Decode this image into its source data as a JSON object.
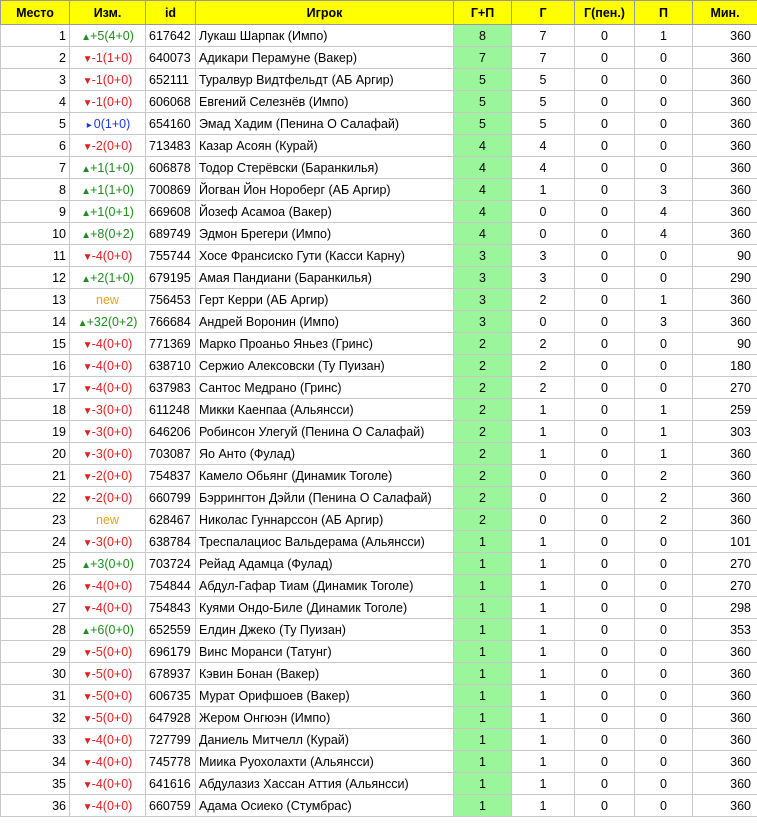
{
  "colors": {
    "header_bg": "#ffff00",
    "points_bg": "#9bf59b",
    "up": "#1e8c1e",
    "down": "#e02020",
    "same": "#1a37e0",
    "new": "#e6a020"
  },
  "icons": {
    "up": "triangle-up-icon",
    "down": "triangle-down-icon",
    "same": "triangle-right-icon"
  },
  "headers": {
    "place": "Место",
    "change": "Изм.",
    "id": "id",
    "player": "Игрок",
    "points": "Г+П",
    "goals": "Г",
    "pen": "Г(пен.)",
    "assists": "П",
    "minutes": "Мин."
  },
  "rows": [
    {
      "place": "1",
      "dir": "up",
      "change": "+5(4+0)",
      "id": "617642",
      "player": "Лукаш Шарпак (Импо)",
      "gp": "8",
      "g": "7",
      "pen": "0",
      "a": "1",
      "min": "360"
    },
    {
      "place": "2",
      "dir": "down",
      "change": "-1(1+0)",
      "id": "640073",
      "player": "Адикари Перамуне (Вакер)",
      "gp": "7",
      "g": "7",
      "pen": "0",
      "a": "0",
      "min": "360"
    },
    {
      "place": "3",
      "dir": "down",
      "change": "-1(0+0)",
      "id": "652111",
      "player": "Туралвур Видтфельдт (АБ Аргир)",
      "gp": "5",
      "g": "5",
      "pen": "0",
      "a": "0",
      "min": "360"
    },
    {
      "place": "4",
      "dir": "down",
      "change": "-1(0+0)",
      "id": "606068",
      "player": "Евгений Селезнёв (Импо)",
      "gp": "5",
      "g": "5",
      "pen": "0",
      "a": "0",
      "min": "360"
    },
    {
      "place": "5",
      "dir": "same",
      "change": "0(1+0)",
      "id": "654160",
      "player": "Эмад Хадим (Пенина О Салафай)",
      "gp": "5",
      "g": "5",
      "pen": "0",
      "a": "0",
      "min": "360"
    },
    {
      "place": "6",
      "dir": "down",
      "change": "-2(0+0)",
      "id": "713483",
      "player": "Казар Асоян (Курай)",
      "gp": "4",
      "g": "4",
      "pen": "0",
      "a": "0",
      "min": "360"
    },
    {
      "place": "7",
      "dir": "up",
      "change": "+1(1+0)",
      "id": "606878",
      "player": "Тодор Стерёвски (Баранкилья)",
      "gp": "4",
      "g": "4",
      "pen": "0",
      "a": "0",
      "min": "360"
    },
    {
      "place": "8",
      "dir": "up",
      "change": "+1(1+0)",
      "id": "700869",
      "player": "Йогван Йон Нороберг (АБ Аргир)",
      "gp": "4",
      "g": "1",
      "pen": "0",
      "a": "3",
      "min": "360"
    },
    {
      "place": "9",
      "dir": "up",
      "change": "+1(0+1)",
      "id": "669608",
      "player": "Йозеф Асамоа (Вакер)",
      "gp": "4",
      "g": "0",
      "pen": "0",
      "a": "4",
      "min": "360"
    },
    {
      "place": "10",
      "dir": "up",
      "change": "+8(0+2)",
      "id": "689749",
      "player": "Эдмон Брегери (Импо)",
      "gp": "4",
      "g": "0",
      "pen": "0",
      "a": "4",
      "min": "360"
    },
    {
      "place": "11",
      "dir": "down",
      "change": "-4(0+0)",
      "id": "755744",
      "player": "Хосе Франсиско Гути (Касси Карну)",
      "gp": "3",
      "g": "3",
      "pen": "0",
      "a": "0",
      "min": "90"
    },
    {
      "place": "12",
      "dir": "up",
      "change": "+2(1+0)",
      "id": "679195",
      "player": "Амая Пандиани (Баранкилья)",
      "gp": "3",
      "g": "3",
      "pen": "0",
      "a": "0",
      "min": "290"
    },
    {
      "place": "13",
      "dir": "new",
      "change": "new",
      "id": "756453",
      "player": "Герт Керри (АБ Аргир)",
      "gp": "3",
      "g": "2",
      "pen": "0",
      "a": "1",
      "min": "360"
    },
    {
      "place": "14",
      "dir": "up",
      "change": "+32(0+2)",
      "id": "766684",
      "player": "Андрей Воронин (Импо)",
      "gp": "3",
      "g": "0",
      "pen": "0",
      "a": "3",
      "min": "360"
    },
    {
      "place": "15",
      "dir": "down",
      "change": "-4(0+0)",
      "id": "771369",
      "player": "Марко Проаньо Яньез (Гринс)",
      "gp": "2",
      "g": "2",
      "pen": "0",
      "a": "0",
      "min": "90"
    },
    {
      "place": "16",
      "dir": "down",
      "change": "-4(0+0)",
      "id": "638710",
      "player": "Сержио Алексовски (Ту Пуизан)",
      "gp": "2",
      "g": "2",
      "pen": "0",
      "a": "0",
      "min": "180"
    },
    {
      "place": "17",
      "dir": "down",
      "change": "-4(0+0)",
      "id": "637983",
      "player": "Сантос Медрано (Гринс)",
      "gp": "2",
      "g": "2",
      "pen": "0",
      "a": "0",
      "min": "270"
    },
    {
      "place": "18",
      "dir": "down",
      "change": "-3(0+0)",
      "id": "611248",
      "player": "Микки Каенпаа (Альянсси)",
      "gp": "2",
      "g": "1",
      "pen": "0",
      "a": "1",
      "min": "259"
    },
    {
      "place": "19",
      "dir": "down",
      "change": "-3(0+0)",
      "id": "646206",
      "player": "Робинсон Улегуй (Пенина О Салафай)",
      "gp": "2",
      "g": "1",
      "pen": "0",
      "a": "1",
      "min": "303"
    },
    {
      "place": "20",
      "dir": "down",
      "change": "-3(0+0)",
      "id": "703087",
      "player": "Яо Анто (Фулад)",
      "gp": "2",
      "g": "1",
      "pen": "0",
      "a": "1",
      "min": "360"
    },
    {
      "place": "21",
      "dir": "down",
      "change": "-2(0+0)",
      "id": "754837",
      "player": "Камело Обьянг (Динамик Тоголе)",
      "gp": "2",
      "g": "0",
      "pen": "0",
      "a": "2",
      "min": "360"
    },
    {
      "place": "22",
      "dir": "down",
      "change": "-2(0+0)",
      "id": "660799",
      "player": "Бэррингтон Дэйли (Пенина О Салафай)",
      "gp": "2",
      "g": "0",
      "pen": "0",
      "a": "2",
      "min": "360"
    },
    {
      "place": "23",
      "dir": "new",
      "change": "new",
      "id": "628467",
      "player": "Николас Гуннарссон (АБ Аргир)",
      "gp": "2",
      "g": "0",
      "pen": "0",
      "a": "2",
      "min": "360"
    },
    {
      "place": "24",
      "dir": "down",
      "change": "-3(0+0)",
      "id": "638784",
      "player": "Треспалациос Вальдерама (Альянсси)",
      "gp": "1",
      "g": "1",
      "pen": "0",
      "a": "0",
      "min": "101"
    },
    {
      "place": "25",
      "dir": "up",
      "change": "+3(0+0)",
      "id": "703724",
      "player": "Рейад Адамца (Фулад)",
      "gp": "1",
      "g": "1",
      "pen": "0",
      "a": "0",
      "min": "270"
    },
    {
      "place": "26",
      "dir": "down",
      "change": "-4(0+0)",
      "id": "754844",
      "player": "Абдул-Гафар Тиам (Динамик Тоголе)",
      "gp": "1",
      "g": "1",
      "pen": "0",
      "a": "0",
      "min": "270"
    },
    {
      "place": "27",
      "dir": "down",
      "change": "-4(0+0)",
      "id": "754843",
      "player": "Куями Ондо-Биле (Динамик Тоголе)",
      "gp": "1",
      "g": "1",
      "pen": "0",
      "a": "0",
      "min": "298"
    },
    {
      "place": "28",
      "dir": "up",
      "change": "+6(0+0)",
      "id": "652559",
      "player": "Елдин Джеко (Ту Пуизан)",
      "gp": "1",
      "g": "1",
      "pen": "0",
      "a": "0",
      "min": "353"
    },
    {
      "place": "29",
      "dir": "down",
      "change": "-5(0+0)",
      "id": "696179",
      "player": "Винс Моранси (Татунг)",
      "gp": "1",
      "g": "1",
      "pen": "0",
      "a": "0",
      "min": "360"
    },
    {
      "place": "30",
      "dir": "down",
      "change": "-5(0+0)",
      "id": "678937",
      "player": "Кэвин Бонан (Вакер)",
      "gp": "1",
      "g": "1",
      "pen": "0",
      "a": "0",
      "min": "360"
    },
    {
      "place": "31",
      "dir": "down",
      "change": "-5(0+0)",
      "id": "606735",
      "player": "Мурат Орифшоев (Вакер)",
      "gp": "1",
      "g": "1",
      "pen": "0",
      "a": "0",
      "min": "360"
    },
    {
      "place": "32",
      "dir": "down",
      "change": "-5(0+0)",
      "id": "647928",
      "player": "Жером Онгюэн (Импо)",
      "gp": "1",
      "g": "1",
      "pen": "0",
      "a": "0",
      "min": "360"
    },
    {
      "place": "33",
      "dir": "down",
      "change": "-4(0+0)",
      "id": "727799",
      "player": "Даниель Митчелл (Курай)",
      "gp": "1",
      "g": "1",
      "pen": "0",
      "a": "0",
      "min": "360"
    },
    {
      "place": "34",
      "dir": "down",
      "change": "-4(0+0)",
      "id": "745778",
      "player": "Миика Руохолахти (Альянсси)",
      "gp": "1",
      "g": "1",
      "pen": "0",
      "a": "0",
      "min": "360"
    },
    {
      "place": "35",
      "dir": "down",
      "change": "-4(0+0)",
      "id": "641616",
      "player": "Абдулазиз Хассан Аттия (Альянсси)",
      "gp": "1",
      "g": "1",
      "pen": "0",
      "a": "0",
      "min": "360"
    },
    {
      "place": "36",
      "dir": "down",
      "change": "-4(0+0)",
      "id": "660759",
      "player": "Адама Осиеко (Стумбрас)",
      "gp": "1",
      "g": "1",
      "pen": "0",
      "a": "0",
      "min": "360"
    }
  ]
}
